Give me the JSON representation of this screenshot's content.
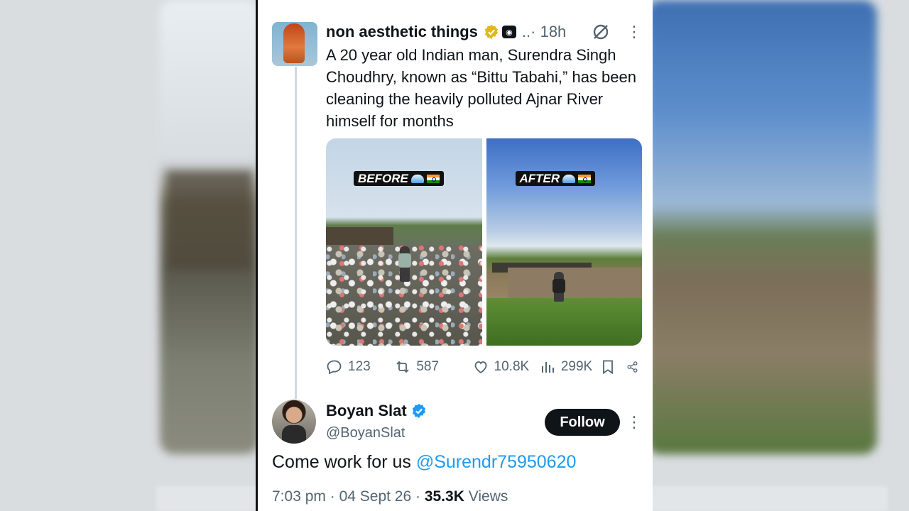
{
  "tweet": {
    "author_name": "non aesthetic things",
    "time_meta": "..· 18h",
    "text": "A 20 year old Indian man, Surendra Singh Choudhry, known as “Bittu Tabahi,” has been cleaning the heavily polluted Ajnar River himself for months",
    "media": [
      {
        "label": "BEFORE"
      },
      {
        "label": "AFTER"
      }
    ],
    "actions": {
      "replies": "123",
      "reposts": "587",
      "likes": "10.8K",
      "views": "299K"
    }
  },
  "reply": {
    "author_name": "Boyan Slat",
    "handle": "@BoyanSlat",
    "follow_label": "Follow",
    "text_prefix": "Come work for us ",
    "mention": "@Surendr75950620",
    "time": "7:03 pm",
    "date": "04 Sept 26",
    "views_count": "35.3K",
    "views_label": "Views"
  },
  "colors": {
    "link": "#1d9bf0",
    "text": "#0f1419",
    "muted": "#536471",
    "verified_gold": "#e2b719",
    "verified_blue": "#1d9bf0"
  }
}
